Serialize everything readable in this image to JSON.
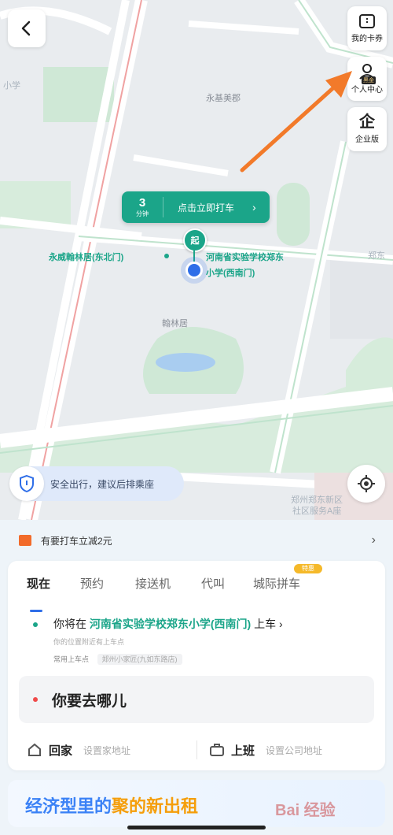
{
  "map": {
    "pickup_eta_value": "3",
    "pickup_eta_unit": "分钟",
    "pickup_cta": "点击立即打车",
    "pickup_pin_label": "起",
    "pickup_point_label_line1": "河南省实验学校郑东",
    "pickup_point_label_line2": "小学(西南门)",
    "nearby_label": "永威翰林居(东北门)",
    "poi_labels": [
      "永基美郡",
      "翰林居",
      "郑东",
      "小学"
    ],
    "faint_labels": [
      "郑州郑东新区",
      "社区服务A座"
    ]
  },
  "side_buttons": [
    {
      "label": "我的卡券",
      "icon": "ticket-icon"
    },
    {
      "label": "个人中心",
      "icon": "user-icon",
      "badge": "黑金"
    },
    {
      "label": "企业版",
      "icon": "enterprise-icon",
      "glyph": "企"
    }
  ],
  "safety": {
    "text": "安全出行，建议后排乘座"
  },
  "promo": {
    "text": "有要打车立减2元"
  },
  "tabs": {
    "items": [
      "现在",
      "预约",
      "接送机",
      "代叫",
      "城际拼车"
    ],
    "active_index": 0,
    "badge": "特惠"
  },
  "start": {
    "prefix": "你将在",
    "place": "河南省实验学校郑东小学(西南门)",
    "suffix": "上车",
    "sub_hint": "你的位置附近有上车点",
    "common_label": "常用上车点",
    "common_value": "郑州小家匠(九如东路店)"
  },
  "destination": {
    "placeholder": "你要去哪儿"
  },
  "shortcuts": [
    {
      "name": "回家",
      "hint": "设置家地址",
      "icon": "home-icon"
    },
    {
      "name": "上班",
      "hint": "设置公司地址",
      "icon": "briefcase-icon"
    }
  ],
  "banner": {
    "part1": "经济型里的",
    "part2": "聚的新出租"
  },
  "watermark": "Bai 经验"
}
